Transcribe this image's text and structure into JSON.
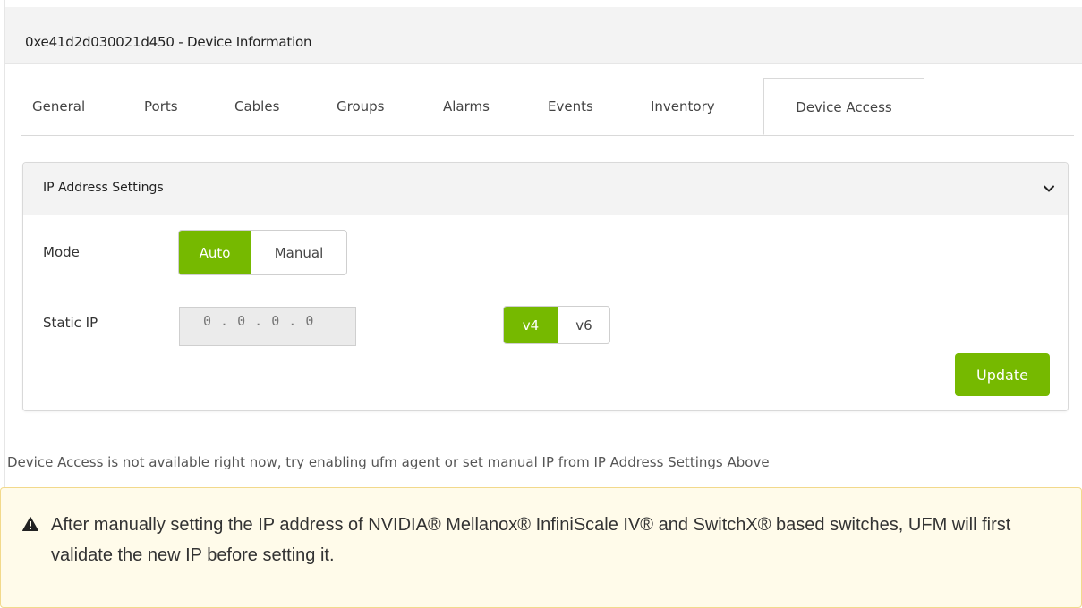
{
  "window": {
    "title": "0xe41d2d030021d450 - Device Information"
  },
  "tabs": [
    {
      "label": "General"
    },
    {
      "label": "Ports"
    },
    {
      "label": "Cables"
    },
    {
      "label": "Groups"
    },
    {
      "label": "Alarms"
    },
    {
      "label": "Events"
    },
    {
      "label": "Inventory"
    },
    {
      "label": "Device Access",
      "active": true
    }
  ],
  "ip_settings": {
    "title": "IP Address Settings",
    "collapse_icon": "chevron-down-icon",
    "mode": {
      "label": "Mode",
      "options": [
        "Auto",
        "Manual"
      ],
      "selected": "Auto"
    },
    "static_ip": {
      "label": "Static IP",
      "value": "0 . 0 . 0 . 0",
      "version_options": [
        "v4",
        "v6"
      ],
      "version_selected": "v4"
    },
    "update_label": "Update"
  },
  "notice": "Device Access is not available right now, try enabling ufm agent or set manual IP from IP Address Settings Above",
  "warning": {
    "icon": "warning-icon",
    "text": "After manually setting the IP address of NVIDIA® Mellanox® InfiniScale IV® and SwitchX® based switches, UFM will first validate the new IP before setting it."
  },
  "colors": {
    "accent": "#76b900",
    "warning_bg": "#fffbea",
    "warning_border": "#f2d98b"
  }
}
